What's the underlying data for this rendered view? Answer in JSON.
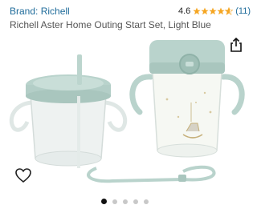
{
  "product": {
    "brand_label": "Brand: Richell",
    "rating_value": "4.6",
    "rating_stars": 4.6,
    "review_count": "(11)",
    "title": "Richell Aster Home Outing Start Set, Light Blue"
  },
  "icons": {
    "share": "share-icon",
    "wishlist": "heart-outline-icon",
    "star": "star-icon"
  },
  "carousel": {
    "total": 5,
    "active_index": 0
  },
  "colors": {
    "brand_link": "#1e6b9a",
    "star": "#f5a623",
    "cup_accent": "#b9d3cc"
  }
}
